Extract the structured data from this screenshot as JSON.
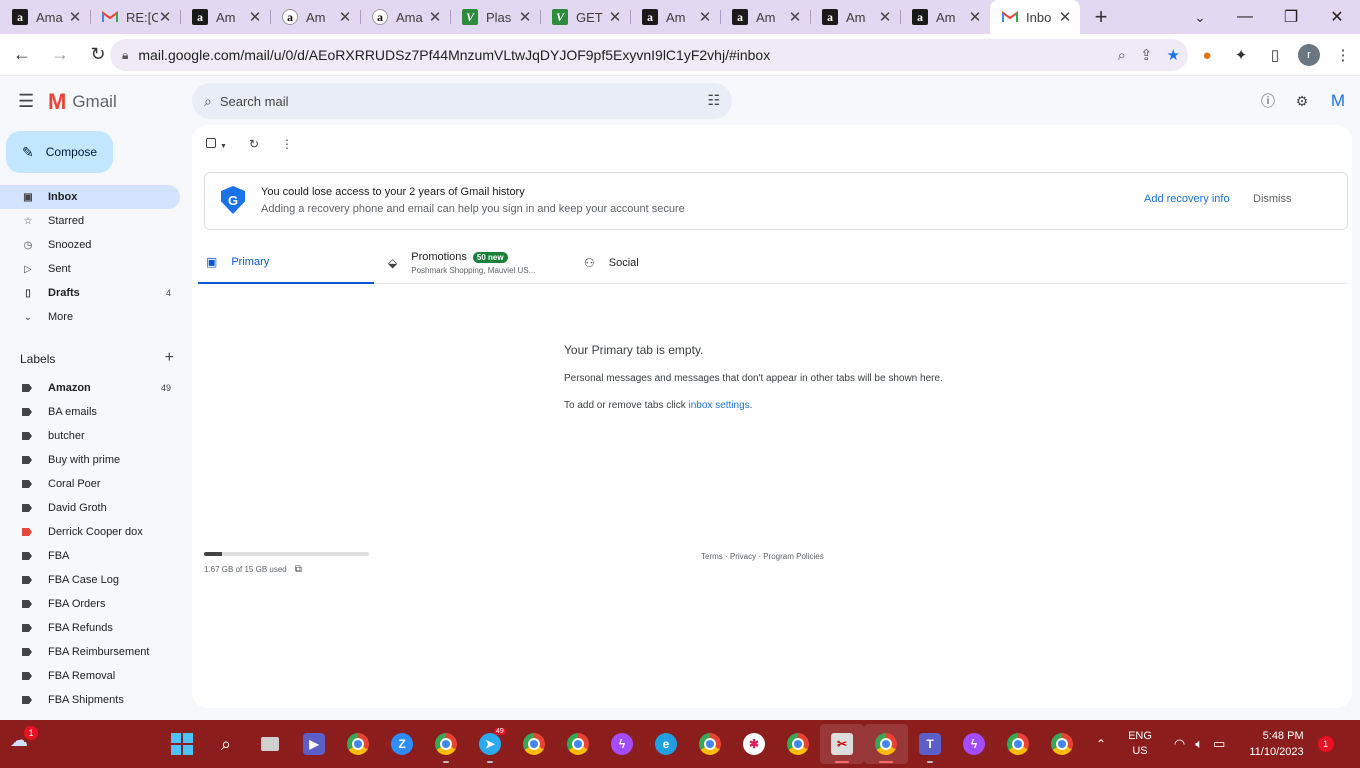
{
  "browser": {
    "tabs": [
      {
        "title": "Ama",
        "icon": "amazon"
      },
      {
        "title": "RE:[C",
        "icon": "gmail"
      },
      {
        "title": "Am",
        "icon": "amazon"
      },
      {
        "title": "Am",
        "icon": "amazon-circle"
      },
      {
        "title": "Ama",
        "icon": "amazon-circle"
      },
      {
        "title": "Plas",
        "icon": "plastic"
      },
      {
        "title": "GET",
        "icon": "plastic"
      },
      {
        "title": "Am",
        "icon": "amazon"
      },
      {
        "title": "Am",
        "icon": "amazon"
      },
      {
        "title": "Am",
        "icon": "amazon"
      },
      {
        "title": "Am",
        "icon": "amazon"
      },
      {
        "title": "Inbo",
        "icon": "gmail",
        "active": true
      }
    ],
    "url": "mail.google.com/mail/u/0/d/AEoRXRRUDSz7Pf44MnzumVLtwJqDYJOF9pf5ExyvnI9lC1yF2vhj/#inbox",
    "profile_initial": "r"
  },
  "gmail": {
    "app_name": "Gmail",
    "search_placeholder": "Search mail",
    "avatar_initial": "M",
    "compose_label": "Compose",
    "nav": [
      {
        "label": "Inbox",
        "icon": "inbox-icon",
        "active": true
      },
      {
        "label": "Starred",
        "icon": "star-icon"
      },
      {
        "label": "Snoozed",
        "icon": "clock-icon"
      },
      {
        "label": "Sent",
        "icon": "send-icon"
      },
      {
        "label": "Drafts",
        "icon": "draft-icon",
        "count": "4",
        "bold": true
      },
      {
        "label": "More",
        "icon": "chevron-down-icon"
      }
    ],
    "labels_title": "Labels",
    "labels": [
      {
        "label": "Amazon",
        "count": "49",
        "bold": true,
        "color": "#444444"
      },
      {
        "label": "BA emails",
        "color": "#444444"
      },
      {
        "label": "butcher",
        "color": "#444444"
      },
      {
        "label": "Buy with prime",
        "color": "#444444"
      },
      {
        "label": "Coral Poer",
        "color": "#444444"
      },
      {
        "label": "David Groth",
        "color": "#444444"
      },
      {
        "label": "Derrick Cooper dox",
        "color": "#e8453c"
      },
      {
        "label": "FBA",
        "color": "#444444"
      },
      {
        "label": "FBA Case Log",
        "color": "#444444"
      },
      {
        "label": "FBA Orders",
        "color": "#444444"
      },
      {
        "label": "FBA Refunds",
        "color": "#444444"
      },
      {
        "label": "FBA Reimbursement",
        "color": "#444444"
      },
      {
        "label": "FBA Removal",
        "color": "#444444"
      },
      {
        "label": "FBA Shipments",
        "color": "#444444"
      }
    ],
    "banner": {
      "title": "You could lose access to your 2 years of Gmail history",
      "subtitle": "Adding a recovery phone and email can help you sign in and keep your account secure",
      "action": "Add recovery info",
      "dismiss": "Dismiss",
      "shield_letter": "G"
    },
    "tabs": {
      "primary": "Primary",
      "promotions": "Promotions",
      "promotions_badge": "50 new",
      "promotions_sub": "Poshmark Shopping, Mauviel US...",
      "social": "Social"
    },
    "empty": {
      "title": "Your Primary tab is empty.",
      "line1": "Personal messages and messages that don't appear in other tabs will be shown here.",
      "line2_prefix": "To add or remove tabs click ",
      "line2_link": "inbox settings",
      "line2_suffix": "."
    },
    "storage": {
      "text": "1.67 GB of 15 GB used",
      "used_fraction": 0.11
    },
    "footer": "Terms · Privacy · Program Policies"
  },
  "taskbar": {
    "weather_badge": "1",
    "lang_line1": "ENG",
    "lang_line2": "US",
    "time": "5:48 PM",
    "date": "11/10/2023",
    "notification_count": "1",
    "telegram_badge": "49"
  }
}
